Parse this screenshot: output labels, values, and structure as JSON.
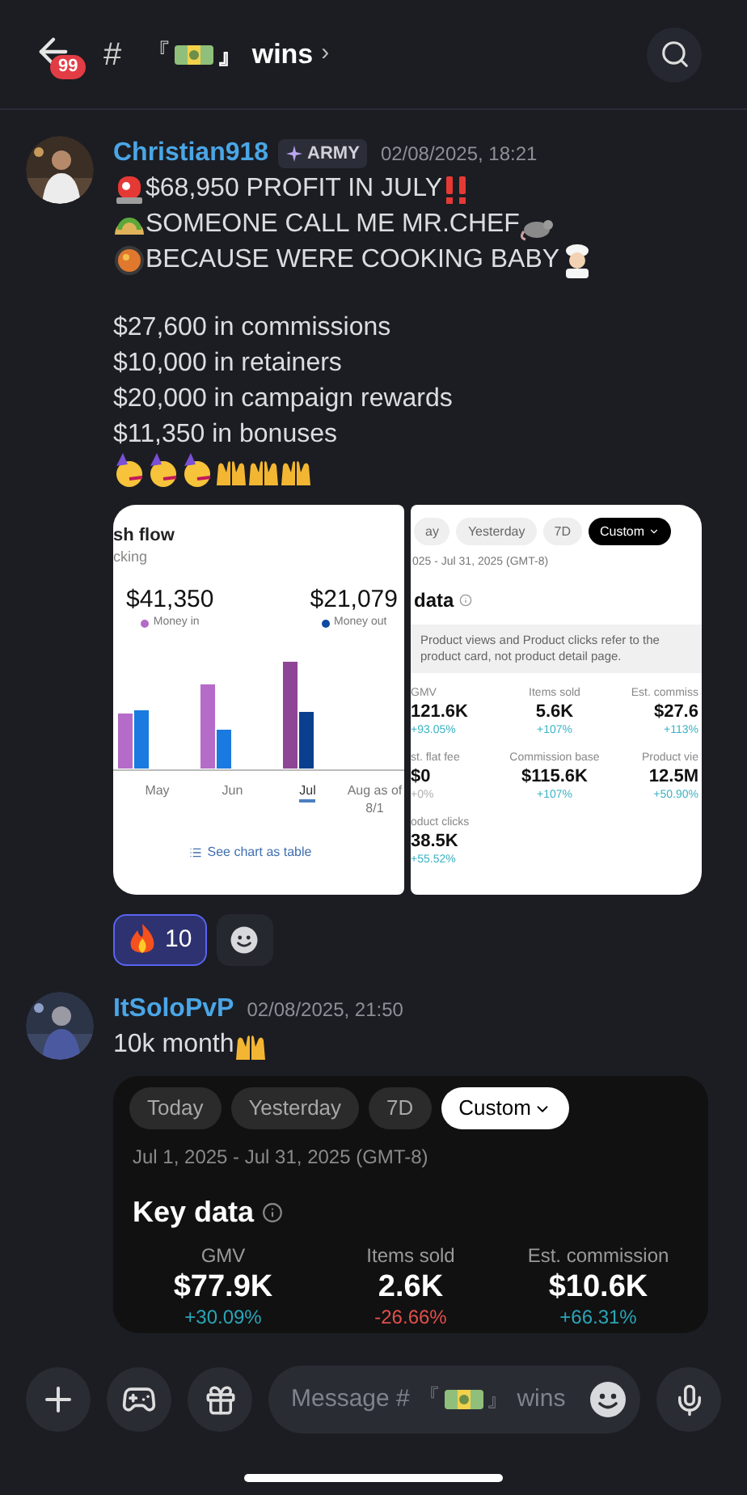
{
  "header": {
    "unread_badge": "99",
    "hash": "#",
    "title_before": "『",
    "title_after": "』 wins",
    "chevron": "›"
  },
  "messages": [
    {
      "author": "Christian918",
      "tag": "ARMY",
      "time": "02/08/2025, 18:21",
      "paragraphs": [
        [
          {
            "parts": [
              {
                "kind": "siren"
              },
              {
                "kind": "text",
                "text": "$68,950 PROFIT IN JULY"
              },
              {
                "kind": "bang"
              }
            ]
          },
          {
            "parts": [
              {
                "kind": "taco"
              },
              {
                "kind": "text",
                "text": "SOMEONE CALL ME MR.CHEF"
              },
              {
                "kind": "rat"
              }
            ]
          },
          {
            "parts": [
              {
                "kind": "bowl"
              },
              {
                "kind": "text",
                "text": "BECAUSE WERE COOKING BABY"
              },
              {
                "kind": "chef"
              }
            ]
          }
        ],
        [
          {
            "parts": [
              {
                "kind": "text",
                "text": "$27,600 in commissions"
              }
            ]
          },
          {
            "parts": [
              {
                "kind": "text",
                "text": "$10,000 in retainers"
              }
            ]
          },
          {
            "parts": [
              {
                "kind": "text",
                "text": "$20,000 in campaign rewards"
              }
            ]
          },
          {
            "parts": [
              {
                "kind": "text",
                "text": "$11,350 in bonuses"
              }
            ]
          },
          {
            "parts": [
              {
                "kind": "party"
              },
              {
                "kind": "party"
              },
              {
                "kind": "party"
              },
              {
                "kind": "hands"
              },
              {
                "kind": "hands"
              },
              {
                "kind": "hands"
              }
            ]
          }
        ]
      ],
      "cashflow": {
        "title": "sh flow",
        "subtitle": "cking",
        "stats": [
          {
            "value": "$41,350",
            "label": "Money in",
            "color": "#b36ac7"
          },
          {
            "value": "$21,079",
            "label": "Money out",
            "color": "#0d4aa0"
          }
        ],
        "months": [
          {
            "label": "May",
            "selected": false
          },
          {
            "label": "Jun",
            "selected": false
          },
          {
            "label": "Jul",
            "selected": true
          },
          {
            "label": "Aug as of 8/1",
            "selected": false
          }
        ],
        "link": "See chart as table"
      },
      "stats_shot": {
        "chips": [
          {
            "label": "ay",
            "selected": false
          },
          {
            "label": "Yesterday",
            "selected": false
          },
          {
            "label": "7D",
            "selected": false
          },
          {
            "label": "Custom",
            "selected": true
          }
        ],
        "range": "025 - Jul 31, 2025 (GMT-8)",
        "title": "data",
        "note": "Product views and Product clicks refer to the product card, not product detail page.",
        "metrics": [
          {
            "label": "GMV",
            "value": "121.6K",
            "change": "+93.05%",
            "color": "#3bb3c3"
          },
          {
            "label": "Items sold",
            "value": "5.6K",
            "change": "+107%",
            "color": "#3bb3c3"
          },
          {
            "label": "Est. commiss",
            "value": "$27.6",
            "change": "+113%",
            "color": "#3bb3c3"
          },
          {
            "label": "st. flat fee",
            "value": "$0",
            "change": "+0%",
            "color": "#b0b0b0"
          },
          {
            "label": "Commission base",
            "value": "$115.6K",
            "change": "+107%",
            "color": "#3bb3c3"
          },
          {
            "label": "Product vie",
            "value": "12.5M",
            "change": "+50.90%",
            "color": "#3bb3c3"
          },
          {
            "label": "oduct clicks",
            "value": "38.5K",
            "change": "+55.52%",
            "color": "#3bb3c3"
          }
        ]
      },
      "reactions": [
        {
          "kind": "fire",
          "count": "10",
          "selected": true
        },
        {
          "kind": "add"
        }
      ]
    },
    {
      "author": "ItSoloPvP",
      "time": "02/08/2025, 21:50",
      "paragraphs": [
        [
          {
            "parts": [
              {
                "kind": "text",
                "text": "10k month"
              },
              {
                "kind": "hands"
              }
            ]
          }
        ]
      ],
      "stats_card": {
        "chips": [
          {
            "label": "Today",
            "selected": false
          },
          {
            "label": "Yesterday",
            "selected": false
          },
          {
            "label": "7D",
            "selected": false
          },
          {
            "label": "Custom",
            "selected": true
          }
        ],
        "range": "Jul 1, 2025 - Jul 31, 2025 (GMT-8)",
        "title": "Key data",
        "metrics": [
          {
            "label": "GMV",
            "value": "$77.9K",
            "change": "+30.09%",
            "color": "#2aa6b8"
          },
          {
            "label": "Items sold",
            "value": "2.6K",
            "change": "-26.66%",
            "color": "#e2504a"
          },
          {
            "label": "Est. commission",
            "value": "$10.6K",
            "change": "+66.31%",
            "color": "#2aa6b8"
          }
        ]
      }
    }
  ],
  "composer": {
    "placeholder_before": "Message # 『",
    "placeholder_after": "』 wins"
  }
}
